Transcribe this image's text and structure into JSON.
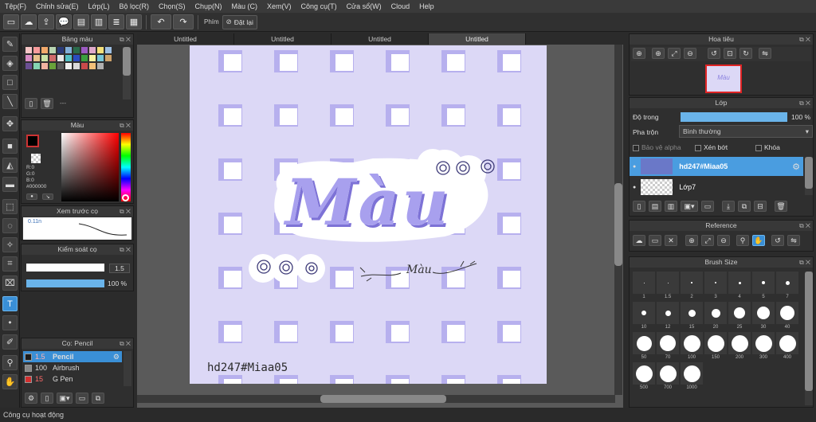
{
  "menu": [
    "Tệp(F)",
    "Chỉnh sửa(E)",
    "Lớp(L)",
    "Bộ lọc(R)",
    "Chọn(S)",
    "Chụp(N)",
    "Màu (C)",
    "Xem(V)",
    "Công cụ(T)",
    "Cửa sổ(W)",
    "Cloud",
    "Help"
  ],
  "toolbar": {
    "phim_label": "Phím",
    "reset_label": "Đặt lại"
  },
  "palette": {
    "title": "Bảng màu",
    "colors": [
      "#f7c6c6",
      "#f79b9b",
      "#f2a96b",
      "#b9d5b1",
      "#2b3b79",
      "#83b0d9",
      "#2a6b4b",
      "#9c5ac2",
      "#e0aacb",
      "#f4e07a",
      "#9dbfe3",
      "#d88cc4",
      "#e8c18b",
      "#cbe3a6",
      "#d06a6a",
      "#e8e8e8",
      "#52c0c4",
      "#2a4cc1",
      "#3b9f3e",
      "#f7f2a1",
      "#77c6d8",
      "#cfa36b",
      "#6a4f93",
      "#84d4b2",
      "#f2b3a1",
      "#69a23a",
      "#5b5b5b",
      "#f0f0f0",
      "#d9d9d9",
      "#c84a4a",
      "#f2c079",
      "#b0b0b0"
    ],
    "footer_text": "---"
  },
  "color_panel": {
    "title": "Màu",
    "rgb": [
      "R:0",
      "G:0",
      "B:0"
    ],
    "hex": "#000000"
  },
  "brush_preview": {
    "title": "Xem trước cọ",
    "size_label": "0.11n"
  },
  "brush_control": {
    "title": "Kiểm soát cọ",
    "size": "1.5",
    "opacity": "100 %",
    "opacity_value": 1.0
  },
  "brush_list": {
    "title": "Cọ: Pencil",
    "items": [
      {
        "size": "1.5",
        "name": "Pencil",
        "color": "#1c1c1c",
        "active": true
      },
      {
        "size": "100",
        "name": "Airbrush",
        "color": "#888888",
        "active": false
      },
      {
        "size": "15",
        "name": "G Pen",
        "color": "#d32f2f",
        "active": false
      }
    ]
  },
  "tabs": [
    "Untitled",
    "Untitled",
    "Untitled",
    "Untitled"
  ],
  "canvas": {
    "title_text": "Màu",
    "sub_text": "Màu",
    "watermark": "hd247#Miaa05"
  },
  "navigator": {
    "title": "Hoa tiêu",
    "thumb_text": "Màu"
  },
  "layers": {
    "title": "Lớp",
    "opacity_label": "Độ trong",
    "opacity_value": "100 %",
    "opacity_fraction": 1.0,
    "blend_label": "Pha trộn",
    "blend_value": "Bình thường",
    "alpha_lock": "Bảo vệ alpha",
    "clipping": "Xén bớt",
    "lock": "Khóa",
    "items": [
      {
        "name": "hd247#Miaa05",
        "active": true
      },
      {
        "name": "Lớp7",
        "active": false
      }
    ]
  },
  "reference": {
    "title": "Reference"
  },
  "brush_size": {
    "title": "Brush Size",
    "sizes": [
      "1",
      "1.5",
      "2",
      "3",
      "4",
      "5",
      "7",
      "10",
      "12",
      "15",
      "20",
      "25",
      "30",
      "40",
      "50",
      "70",
      "100",
      "150",
      "200",
      "300",
      "400",
      "500",
      "700",
      "1000"
    ]
  },
  "status": {
    "text": "Công cụ hoạt động"
  }
}
